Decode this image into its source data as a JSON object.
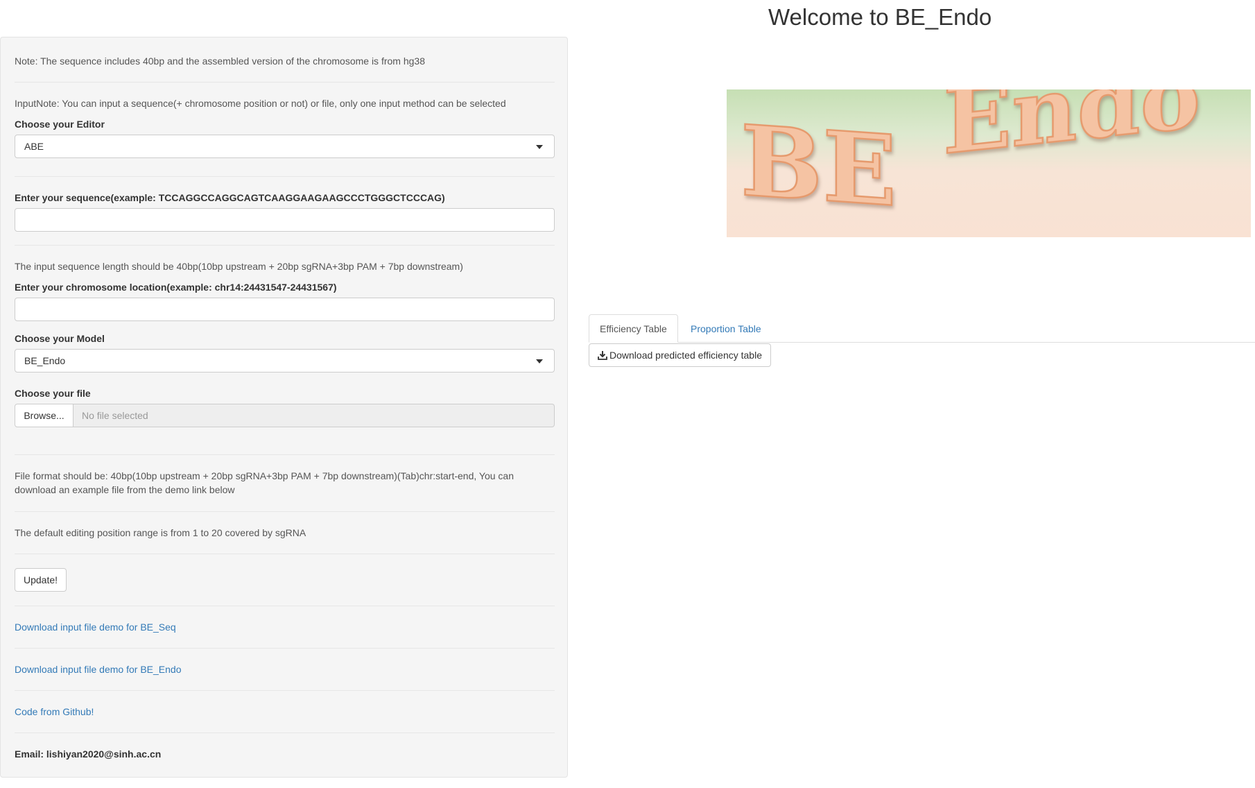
{
  "header": {
    "title": "Welcome to BE_Endo"
  },
  "sidebar": {
    "note1": "Note: The sequence includes 40bp and the assembled version of the chromosome is from hg38",
    "input_note": "InputNote: You can input a sequence(+ chromosome position or not) or file, only one input method can be selected",
    "editor": {
      "label": "Choose your Editor",
      "selected": "ABE"
    },
    "sequence": {
      "label": "Enter your sequence(example: TCCAGGCCAGGCAGTCAAGGAAGAAGCCCTGGGCTCCCAG)",
      "value": ""
    },
    "length_note": "The input sequence length should be 40bp(10bp upstream + 20bp sgRNA+3bp PAM + 7bp downstream)",
    "chromosome": {
      "label": "Enter your chromosome location(example: chr14:24431547-24431567)",
      "value": ""
    },
    "model": {
      "label": "Choose your Model",
      "selected": "BE_Endo"
    },
    "file": {
      "label": "Choose your file",
      "browse_label": "Browse...",
      "placeholder": "No file selected"
    },
    "file_format_note": "File format should be: 40bp(10bp upstream + 20bp sgRNA+3bp PAM + 7bp downstream)(Tab)chr:start-end, You can download an example file from the demo link below",
    "default_note": "The default editing position range is from 1 to 20 covered by sgRNA",
    "update_label": "Update!",
    "links": {
      "demo_seq": "Download input file demo for BE_Seq",
      "demo_endo": "Download input file demo for BE_Endo",
      "github": "Code from Github!"
    },
    "email": "Email: lishiyan2020@sinh.ac.cn"
  },
  "banner": {
    "text": "BE Endo"
  },
  "main": {
    "tabs": [
      {
        "label": "Efficiency Table",
        "active": true
      },
      {
        "label": "Proportion Table",
        "active": false
      }
    ],
    "download_label": "Download predicted efficiency table"
  },
  "colors": {
    "link": "#337ab7",
    "banner_text_fill": "#f5c3a3",
    "banner_text_stroke": "#e69a6d",
    "banner_top": "#c6dfb4",
    "banner_bottom": "#f9e2d3"
  }
}
